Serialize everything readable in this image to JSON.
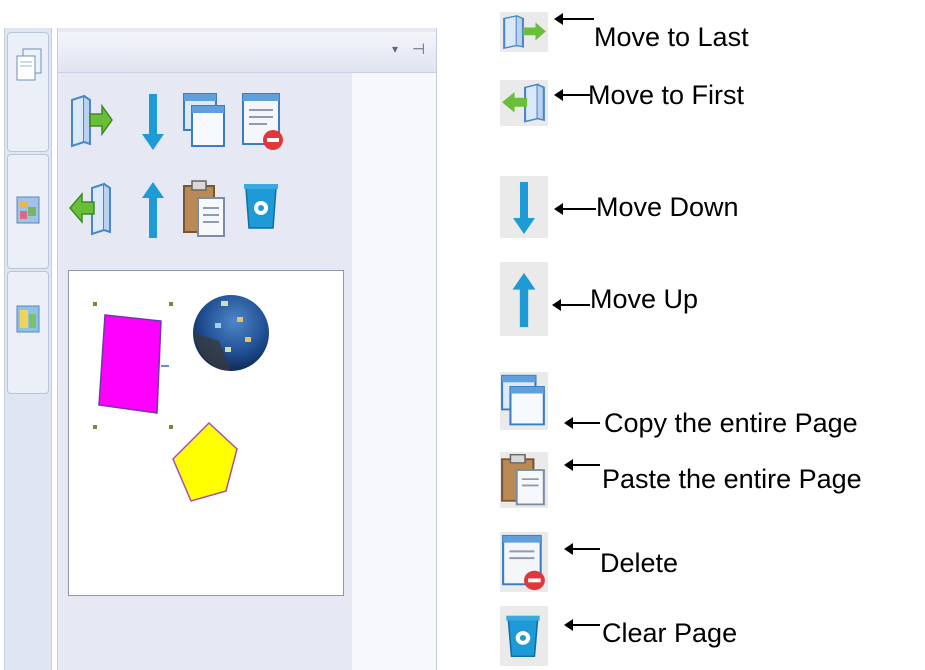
{
  "panel": {
    "dropdown_glyph": "▾",
    "pin_glyph": "⊣",
    "side_tabs": [
      {
        "icon": "page-sorter-icon"
      },
      {
        "icon": "gallery-icon"
      },
      {
        "icon": "background-icon"
      }
    ],
    "tools": [
      {
        "icon": "move-to-last-icon"
      },
      {
        "icon": "move-down-icon"
      },
      {
        "icon": "copy-page-icon"
      },
      {
        "icon": "delete-page-icon"
      },
      {
        "icon": "move-to-first-icon"
      },
      {
        "icon": "move-up-icon"
      },
      {
        "icon": "paste-page-icon"
      },
      {
        "icon": "clear-page-icon"
      }
    ],
    "thumbnail": {
      "shapes": [
        "magenta-square",
        "globe-image",
        "yellow-pentagon"
      ]
    }
  },
  "legend": {
    "move_to_last": "Move to Last",
    "move_to_first": "Move to First",
    "move_down": "Move Down",
    "move_up": "Move Up",
    "copy_page": "Copy the entire Page",
    "paste_page": "Paste the entire Page",
    "delete": "Delete",
    "clear_page": "Clear Page"
  },
  "colors": {
    "arrow_blue": "#1e9ad6",
    "book_blue": "#4a86c8",
    "green_arrow": "#6abf3a",
    "delete_red": "#e0383a",
    "magenta": "#ff00ff",
    "yellow": "#ffff00"
  }
}
